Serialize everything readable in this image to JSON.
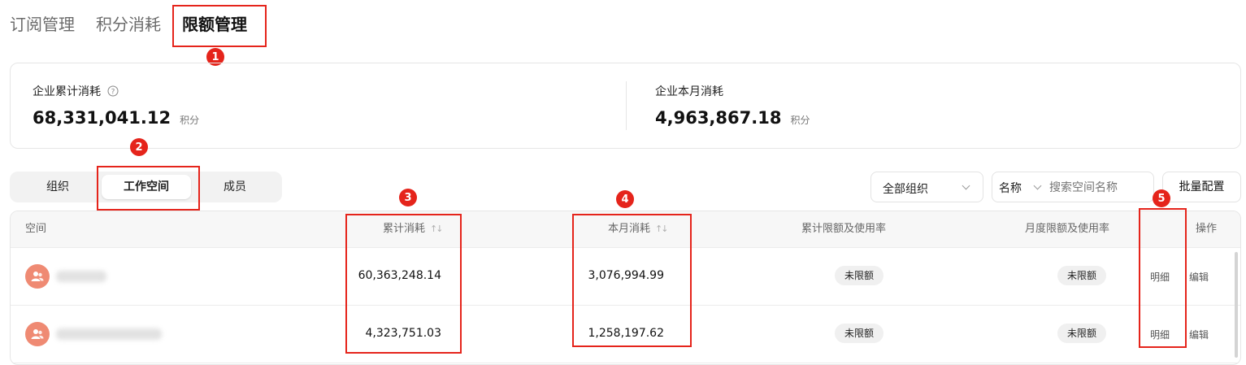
{
  "top_tabs": [
    "订阅管理",
    "积分消耗",
    "限额管理"
  ],
  "stats": {
    "total": {
      "label": "企业累计消耗",
      "value": "68,331,041.12",
      "unit": "积分"
    },
    "month": {
      "label": "企业本月消耗",
      "value": "4,963,867.18",
      "unit": "积分"
    }
  },
  "segments": [
    "组织",
    "工作空间",
    "成员"
  ],
  "filters": {
    "org_select": "全部组织",
    "field_select": "名称",
    "search_placeholder": "搜索空间名称",
    "batch_button": "批量配置"
  },
  "table": {
    "headers": {
      "space": "空间",
      "total": "累计消耗",
      "month": "本月消耗",
      "total_limit": "累计限额及使用率",
      "month_limit": "月度限额及使用率",
      "actions": "操作"
    },
    "rows": [
      {
        "total": "60,363,248.14",
        "month": "3,076,994.99",
        "total_limit": "未限额",
        "month_limit": "未限额",
        "detail": "明细",
        "edit": "编辑"
      },
      {
        "total": "4,323,751.03",
        "month": "1,258,197.62",
        "total_limit": "未限额",
        "month_limit": "未限额",
        "detail": "明细",
        "edit": "编辑"
      }
    ]
  },
  "annotations": [
    "1",
    "2",
    "3",
    "4",
    "5"
  ],
  "colors": {
    "annotation": "#e5241b",
    "avatar": "#ef8a73"
  }
}
